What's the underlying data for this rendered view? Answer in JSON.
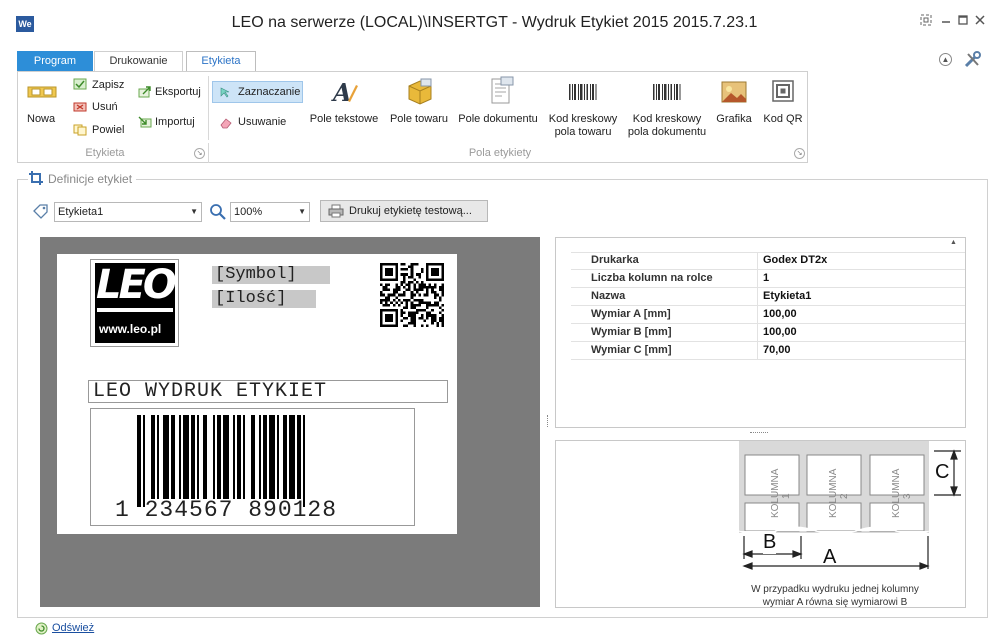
{
  "window": {
    "title": "LEO na serwerze (LOCAL)\\INSERTGT - Wydruk Etykiet 2015 2015.7.23.1",
    "app_icon_text": "We"
  },
  "tabs": [
    {
      "label": "Program"
    },
    {
      "label": "Drukowanie"
    },
    {
      "label": "Etykieta"
    }
  ],
  "ribbon": {
    "groups": {
      "etykieta": "Etykieta",
      "pola": "Pola etykiety"
    },
    "buttons": {
      "nowa": "Nowa",
      "zapisz": "Zapisz",
      "usun": "Usuń",
      "powiel": "Powiel",
      "eksportuj": "Eksportuj",
      "importuj": "Importuj",
      "zaznaczanie": "Zaznaczanie",
      "usuwanie": "Usuwanie",
      "pole_tekstowe": "Pole tekstowe",
      "pole_towaru": "Pole towaru",
      "pole_dokumentu": "Pole dokumentu",
      "kod_kreskowy_towaru_1": "Kod kreskowy",
      "kod_kreskowy_towaru_2": "pola towaru",
      "kod_kreskowy_dokumentu_1": "Kod kreskowy",
      "kod_kreskowy_dokumentu_2": "pola dokumentu",
      "grafika": "Grafika",
      "kod_qr": "Kod QR"
    }
  },
  "definitions": {
    "title": "Definicje etykiet",
    "label_select": "Etykieta1",
    "zoom_select": "100%",
    "print_test": "Drukuj etykietę testową..."
  },
  "label": {
    "symbol_field": "[Symbol]",
    "quantity_field": "[Ilość]",
    "logo_text": "LEO",
    "logo_url": "www.leo.pl",
    "title_field": "LEO WYDRUK ETYKIET",
    "barcode_number": "1 234567 890128"
  },
  "properties": [
    {
      "key": "Drukarka",
      "value": "Godex DT2x"
    },
    {
      "key": "Liczba kolumn na rolce",
      "value": "1"
    },
    {
      "key": "Nazwa",
      "value": "Etykieta1"
    },
    {
      "key": "Wymiar A [mm]",
      "value": "100,00"
    },
    {
      "key": "Wymiar B [mm]",
      "value": "100,00"
    },
    {
      "key": "Wymiar C [mm]",
      "value": "70,00"
    }
  ],
  "diagram": {
    "columns": [
      "KOLUMNA 1",
      "KOLUMNA 2",
      "KOLUMNA 3"
    ],
    "dim_a": "A",
    "dim_b": "B",
    "dim_c": "C",
    "note_line1": "W przypadku wydruku jednej kolumny",
    "note_line2": "wymiar A równa się wymiarowi B"
  },
  "footer": {
    "refresh": "Odśwież"
  },
  "colors": {
    "accent": "#2d8ed8",
    "selected": "#cde4f7",
    "preview_bg": "#7b7b7b"
  }
}
